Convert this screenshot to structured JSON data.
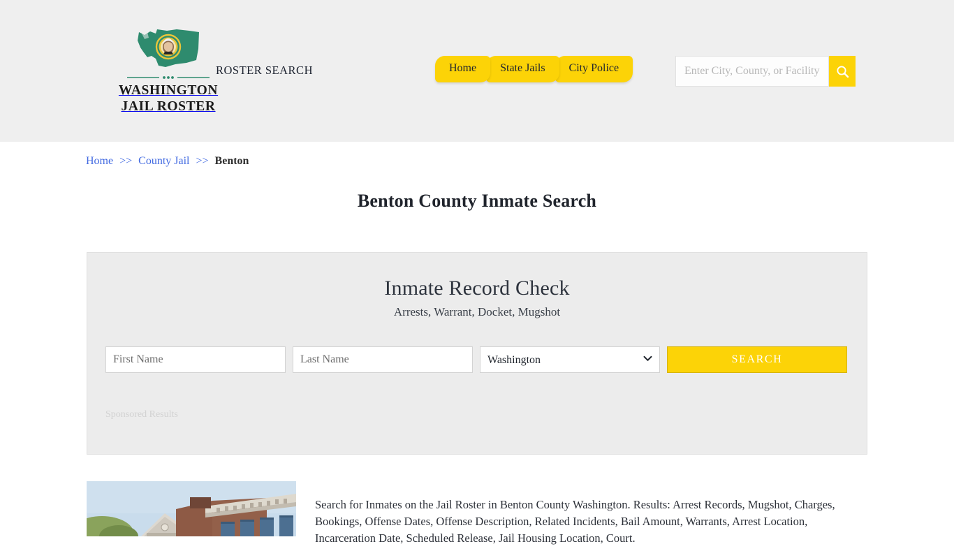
{
  "header": {
    "logo": {
      "flag_icon": "washington-state-flag-icon",
      "divider_icon": "ornamental-divider-icon",
      "wordmark_line1": "WASHINGTON",
      "wordmark_line2": "JAIL ROSTER"
    },
    "tagline": "ROSTER SEARCH",
    "nav": [
      {
        "label": "Home",
        "name": "nav-item-home"
      },
      {
        "label": "State Jails",
        "name": "nav-item-state-jails"
      },
      {
        "label": "City Police",
        "name": "nav-item-city-police"
      }
    ],
    "search": {
      "placeholder": "Enter City, County, or Facility",
      "value": "",
      "button_icon": "search-icon"
    }
  },
  "breadcrumb": {
    "home": "Home",
    "sep1": ">>",
    "county_jail": "County Jail",
    "sep2": ">>",
    "current": "Benton"
  },
  "page": {
    "title": "Benton County Inmate Search"
  },
  "panel": {
    "title": "Inmate Record Check",
    "subtitle": "Arrests, Warrant, Docket, Mugshot",
    "form": {
      "first_name_placeholder": "First Name",
      "first_name_value": "",
      "last_name_placeholder": "Last Name",
      "last_name_value": "",
      "state_selected": "Washington",
      "state_options": [
        "Washington"
      ],
      "chevron_icon": "chevron-down-icon",
      "submit_label": "SEARCH"
    },
    "sponsored_label": "Sponsored Results"
  },
  "article": {
    "photo_alt": "benton-county-courthouse-photo",
    "body": "Search for Inmates on the Jail Roster in Benton County Washington. Results: Arrest Records, Mugshot, Charges, Bookings, Offense Dates, Offense Description, Related Incidents, Bail Amount, Warrants, Arrest Location, Incarceration Date, Scheduled Release, Jail Housing Location, Court."
  },
  "colors": {
    "accent_yellow": "#FCD307",
    "header_bg": "#efefef",
    "panel_bg": "#ececec",
    "link_blue": "#4169e1",
    "flag_green": "#2e8b6e"
  }
}
